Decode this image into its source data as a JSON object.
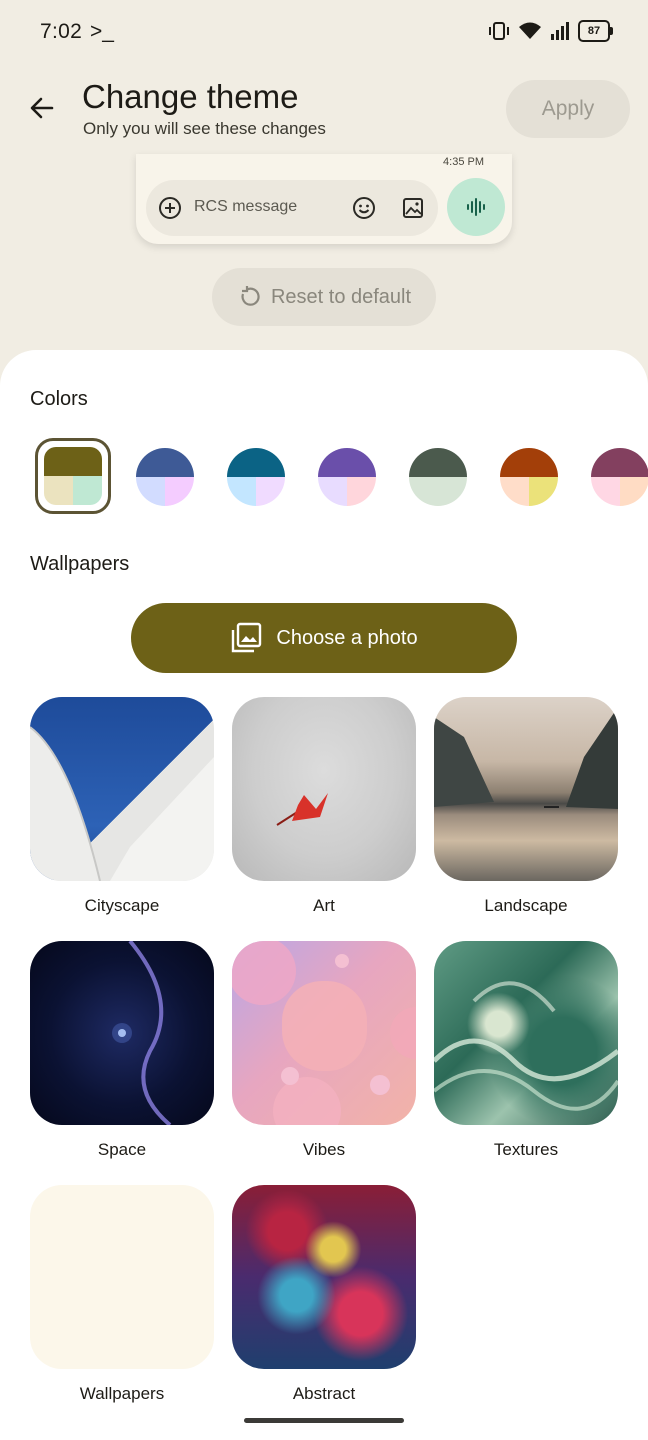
{
  "status_bar": {
    "time": "7:02",
    "terminal_glyph": ">_",
    "battery": "87"
  },
  "header": {
    "title": "Change theme",
    "subtitle": "Only you will see these changes",
    "apply_label": "Apply"
  },
  "preview": {
    "time": "4:35 PM",
    "compose_placeholder": "RCS message"
  },
  "reset_label": "Reset to default",
  "colors": {
    "title": "Colors",
    "swatches": [
      {
        "top": "#6d6117",
        "bl": "#ebe3bf",
        "br": "#bfe8d3"
      },
      {
        "top": "#3e5a96",
        "bl": "#d2dcff",
        "br": "#f4ccff"
      },
      {
        "top": "#0b6385",
        "bl": "#c3e6ff",
        "br": "#f0dbff"
      },
      {
        "top": "#6a4faa",
        "bl": "#e8dcff",
        "br": "#ffd6dc"
      },
      {
        "top": "#4b5a4d",
        "bl": "#d7e5d6",
        "br": "#d7e5d6"
      },
      {
        "top": "#a33f09",
        "bl": "#ffddc9",
        "br": "#ebe27a"
      },
      {
        "top": "#83405f",
        "bl": "#ffd7e4",
        "br": "#ffdcc4"
      }
    ]
  },
  "wallpapers": {
    "title": "Wallpapers",
    "choose_label": "Choose a photo",
    "categories": [
      "Cityscape",
      "Art",
      "Landscape",
      "Space",
      "Vibes",
      "Textures",
      "Wallpapers",
      "Abstract"
    ]
  }
}
